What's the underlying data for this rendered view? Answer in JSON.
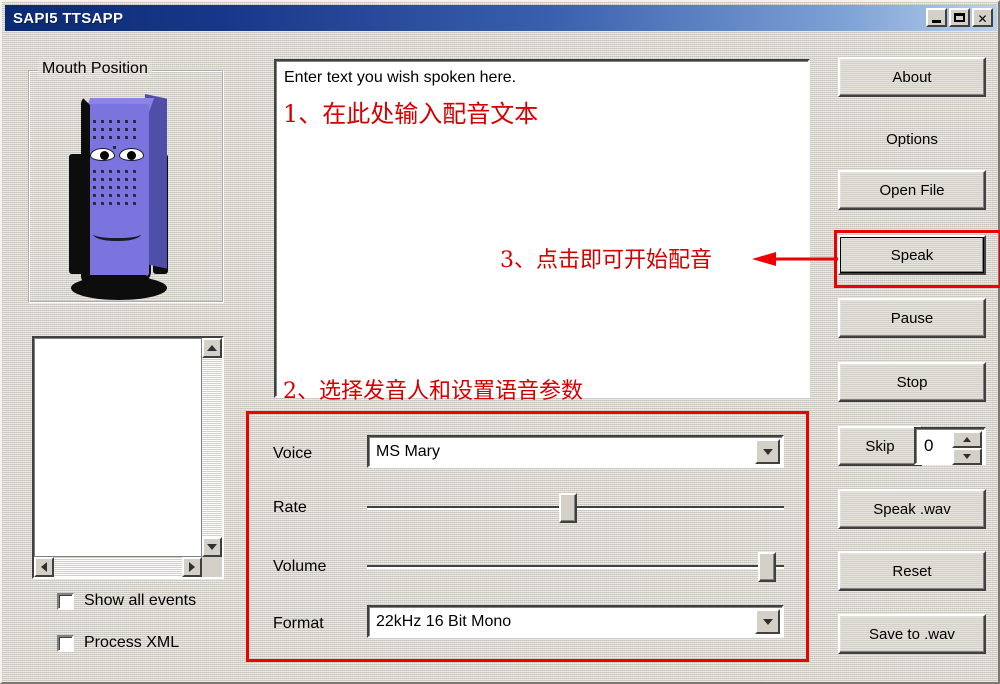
{
  "window": {
    "title": "SAPI5 TTSAPP",
    "controls": [
      {
        "name": "minimize",
        "glyph": "minimize-icon"
      },
      {
        "name": "maximize",
        "glyph": "maximize-icon"
      },
      {
        "name": "close",
        "glyph": "close-icon",
        "label": "✕"
      }
    ]
  },
  "mouth_group": {
    "legend": "Mouth Position"
  },
  "text_area": {
    "value": "Enter text you wish spoken here."
  },
  "annotations": {
    "step1": "1、在此处输入配音文本",
    "step2": "2、选择发音人和设置语音参数",
    "step3": "3、点击即可开始配音",
    "color": "#ee0000"
  },
  "checkboxes": [
    {
      "label": "Show all events",
      "checked": false
    },
    {
      "label": "Process XML",
      "checked": false
    }
  ],
  "settings": {
    "voice": {
      "label": "Voice",
      "value": "MS Mary"
    },
    "rate": {
      "label": "Rate",
      "percent": 48
    },
    "volume": {
      "label": "Volume",
      "percent": 98
    },
    "format": {
      "label": "Format",
      "value": "22kHz 16 Bit Mono"
    }
  },
  "buttons": {
    "about": "About",
    "options": "Options",
    "open_file": "Open File",
    "speak": "Speak",
    "pause": "Pause",
    "stop": "Stop",
    "skip": "Skip",
    "skip_value": "0",
    "speak_wav": "Speak .wav",
    "reset": "Reset",
    "save_wav": "Save to .wav"
  }
}
